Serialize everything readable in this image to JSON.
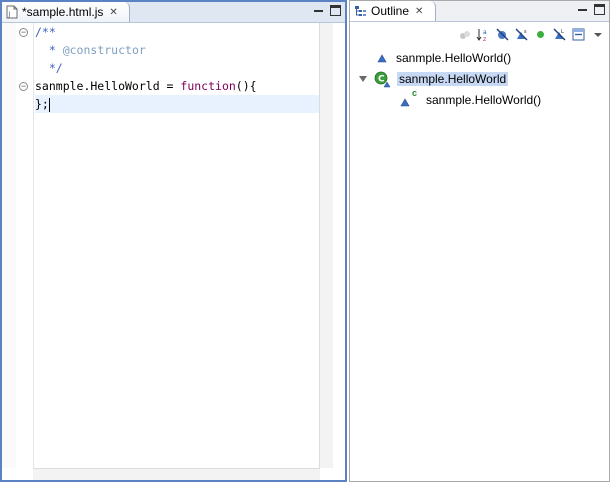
{
  "editor": {
    "tab_title": "*sample.html.js",
    "lines": [
      {
        "parts": [
          {
            "t": "/**",
            "c": "c-comment"
          }
        ]
      },
      {
        "parts": [
          {
            "t": "  * ",
            "c": "c-comment"
          },
          {
            "t": "@constructor",
            "c": "c-tag"
          }
        ]
      },
      {
        "parts": [
          {
            "t": "  */",
            "c": "c-comment"
          }
        ]
      },
      {
        "parts": [
          {
            "t": "sanmple.HelloWorld = ",
            "c": ""
          },
          {
            "t": "function",
            "c": "c-kw"
          },
          {
            "t": "(){",
            "c": ""
          }
        ]
      },
      {
        "parts": [
          {
            "t": "};",
            "c": ""
          }
        ],
        "current": true
      }
    ]
  },
  "outline": {
    "tab_title": "Outline",
    "toolbar_icons": [
      "hide-fields-icon",
      "sort-alphabetically-icon",
      "hide-static-icon",
      "hide-non-public-icon",
      "hide-local-types-icon",
      "public-member-icon",
      "link-with-editor-icon",
      "collapse-all-icon",
      "view-menu-icon"
    ],
    "items": [
      {
        "label": "sanmple.HelloWorld()"
      },
      {
        "label": "sanmple.HelloWorld"
      },
      {
        "label": "sanmple.HelloWorld()",
        "badge": "c"
      }
    ]
  },
  "colors": {
    "active_border": "#5b82c4",
    "selection": "#c6d8f3",
    "current_line": "#e8f2fe"
  }
}
